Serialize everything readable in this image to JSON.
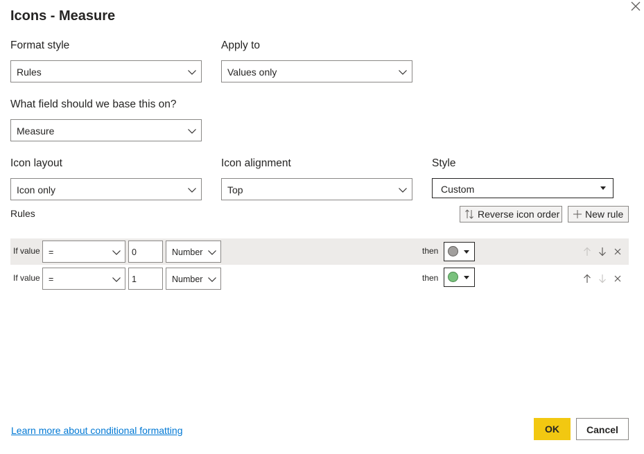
{
  "dialog": {
    "title": "Icons - Measure"
  },
  "format_style": {
    "label": "Format style",
    "value": "Rules"
  },
  "apply_to": {
    "label": "Apply to",
    "value": "Values only"
  },
  "base_field": {
    "label": "What field should we base this on?",
    "value": "Measure"
  },
  "icon_layout": {
    "label": "Icon layout",
    "value": "Icon only"
  },
  "icon_alignment": {
    "label": "Icon alignment",
    "value": "Top"
  },
  "style": {
    "label": "Style",
    "value": "Custom"
  },
  "rules": {
    "label": "Rules",
    "reverse_label": "Reverse icon order",
    "new_rule_label": "New rule",
    "items": [
      {
        "if_label": "If value",
        "operator": "=",
        "value": "0",
        "type": "Number",
        "then_label": "then",
        "icon_color": "#a19f9d",
        "icon_border": "#605e5c"
      },
      {
        "if_label": "If value",
        "operator": "=",
        "value": "1",
        "type": "Number",
        "then_label": "then",
        "icon_color": "#79c17d",
        "icon_border": "#498b4d"
      }
    ]
  },
  "footer": {
    "learn_more": "Learn more about conditional formatting",
    "ok_label": "OK",
    "cancel_label": "Cancel"
  },
  "colors": {
    "accent": "#f2c811",
    "link": "#0078d4",
    "row_highlight": "#edebe9"
  }
}
